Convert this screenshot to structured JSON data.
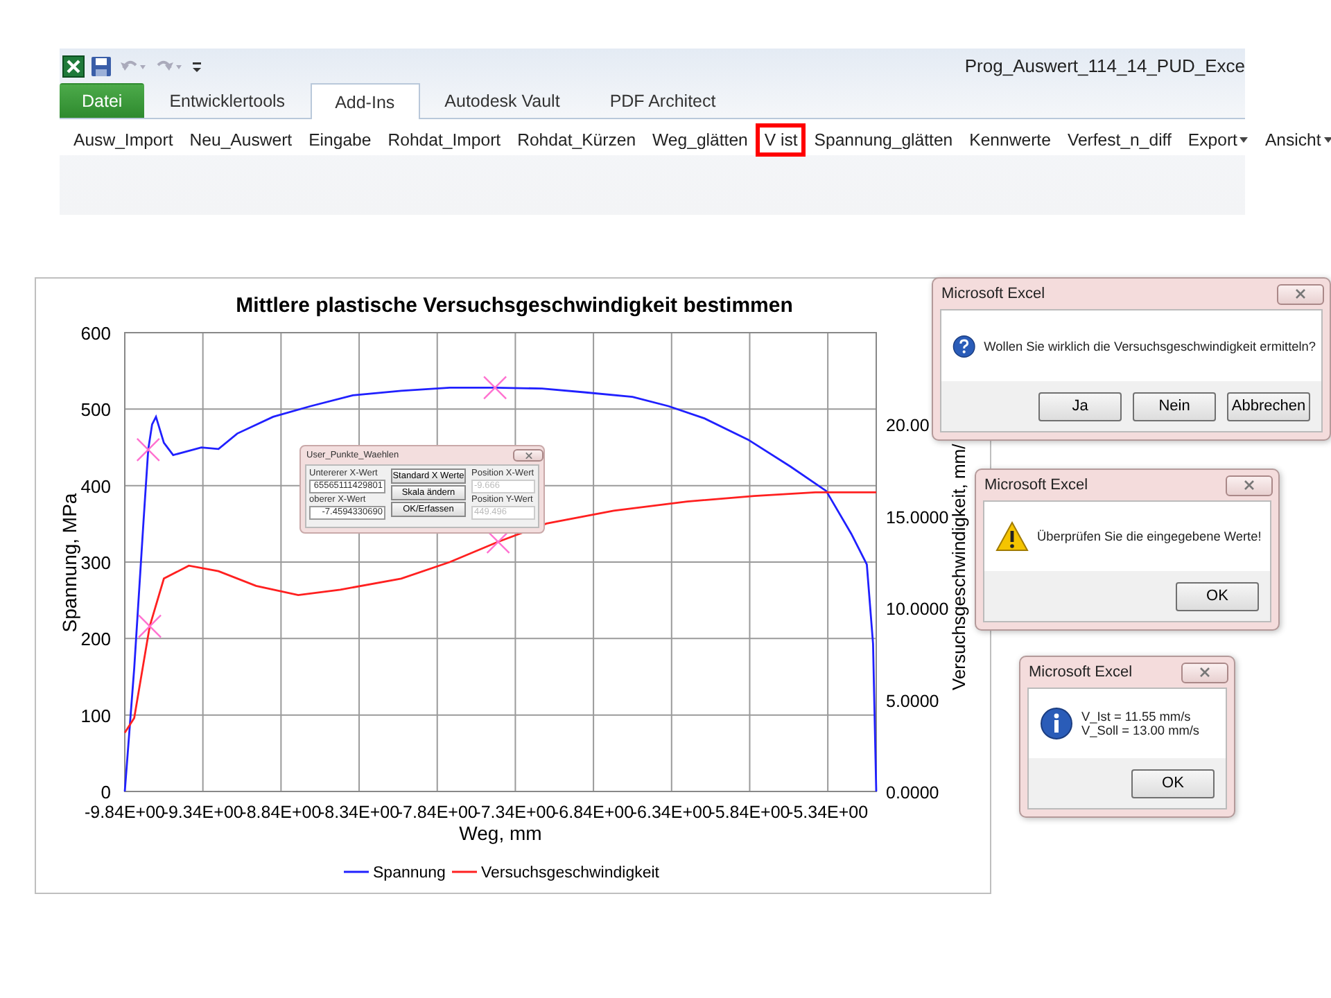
{
  "ribbon": {
    "title": "Prog_Auswert_114_14_PUD_Exce",
    "tabs": [
      {
        "label": "Datei",
        "kind": "file",
        "selected": false
      },
      {
        "label": "Entwicklertools",
        "kind": "tab",
        "selected": false
      },
      {
        "label": "Add-Ins",
        "kind": "tab",
        "selected": true
      },
      {
        "label": "Autodesk Vault",
        "kind": "tab",
        "selected": false
      },
      {
        "label": "PDF Architect",
        "kind": "tab",
        "selected": false
      }
    ],
    "commands": [
      {
        "label": "Ausw_Import",
        "dropdown": false,
        "highlighted": false
      },
      {
        "label": "Neu_Auswert",
        "dropdown": false,
        "highlighted": false
      },
      {
        "label": "Eingabe",
        "dropdown": false,
        "highlighted": false
      },
      {
        "label": "Rohdat_Import",
        "dropdown": false,
        "highlighted": false
      },
      {
        "label": "Rohdat_Kürzen",
        "dropdown": false,
        "highlighted": false
      },
      {
        "label": "Weg_glätten",
        "dropdown": false,
        "highlighted": false
      },
      {
        "label": "V ist",
        "dropdown": false,
        "highlighted": true
      },
      {
        "label": "Spannung_glätten",
        "dropdown": false,
        "highlighted": false
      },
      {
        "label": "Kennwerte",
        "dropdown": false,
        "highlighted": false
      },
      {
        "label": "Verfest_n_diff",
        "dropdown": false,
        "highlighted": false
      },
      {
        "label": "Export",
        "dropdown": true,
        "highlighted": false
      },
      {
        "label": "Ansicht",
        "dropdown": true,
        "highlighted": false
      }
    ]
  },
  "chart": {
    "chart_data": {
      "type": "line",
      "title": "Mittlere plastische Versuchsgeschwindigkeit bestimmen",
      "xlabel": "Weg, mm",
      "ylabel": "Spannung, MPa",
      "y2label": "Versuchsgeschwindigkeit, mm/",
      "xlim": [
        -9.84,
        -5.03
      ],
      "ylim": [
        0,
        600
      ],
      "y2lim": [
        0,
        25
      ],
      "xticks": [
        {
          "value": -9.84,
          "label": "-9.84E+00"
        },
        {
          "value": -9.34,
          "label": "-9.34E+00"
        },
        {
          "value": -8.84,
          "label": "-8.84E+00"
        },
        {
          "value": -8.34,
          "label": "-8.34E+00"
        },
        {
          "value": -7.84,
          "label": "-7.84E+00"
        },
        {
          "value": -7.34,
          "label": "-7.34E+00"
        },
        {
          "value": -6.84,
          "label": "-6.84E+00"
        },
        {
          "value": -6.34,
          "label": "-6.34E+00"
        },
        {
          "value": -5.84,
          "label": "-5.84E+00"
        },
        {
          "value": -5.34,
          "label": "-5.34E+00"
        }
      ],
      "yticks": [
        0,
        100,
        200,
        300,
        400,
        500,
        600
      ],
      "y2ticks": [
        {
          "value": 0,
          "label": "0.0000"
        },
        {
          "value": 5,
          "label": "5.0000"
        },
        {
          "value": 10,
          "label": "10.0000"
        },
        {
          "value": 15,
          "label": "15.0000"
        },
        {
          "value": 20,
          "label": "20.00"
        }
      ],
      "grid": true,
      "legend": true,
      "series": [
        {
          "name": "Spannung",
          "color": "#2020ff",
          "axis": "y",
          "x": [
            -9.84,
            -9.78,
            -9.72,
            -9.69,
            -9.665,
            -9.64,
            -9.59,
            -9.53,
            -9.35,
            -9.24,
            -9.12,
            -8.89,
            -8.65,
            -8.38,
            -8.07,
            -7.76,
            -7.47,
            -7.17,
            -6.9,
            -6.59,
            -6.36,
            -6.13,
            -5.85,
            -5.58,
            -5.35,
            -5.19,
            -5.09,
            -5.05,
            -5.03
          ],
          "values": [
            0,
            161,
            353,
            447,
            480,
            490,
            456,
            440,
            450,
            448,
            468,
            490,
            504,
            518,
            524,
            528,
            528,
            527,
            522,
            516,
            504,
            488,
            460,
            425,
            393,
            337,
            297,
            193,
            0
          ]
        },
        {
          "name": "Versuchsgeschwindigkeit",
          "color": "#ff2020",
          "axis": "y2",
          "x": [
            -9.84,
            -9.78,
            -9.68,
            -9.59,
            -9.43,
            -9.24,
            -9.0,
            -8.73,
            -8.46,
            -8.07,
            -7.76,
            -7.45,
            -7.14,
            -6.71,
            -6.24,
            -5.81,
            -5.42,
            -5.03
          ],
          "values": [
            3.2,
            4.0,
            9.0,
            11.6,
            12.3,
            12.0,
            11.2,
            10.7,
            11.0,
            11.6,
            12.5,
            13.6,
            14.6,
            15.3,
            15.8,
            16.1,
            16.3,
            16.3
          ]
        }
      ]
    }
  },
  "point_dialog": {
    "title": "User_Punkte_Waehlen",
    "left_fields": [
      {
        "label": "Untererer X-Wert",
        "value": "65565111429801",
        "disabled": false
      },
      {
        "label": "oberer X-Wert",
        "value": "-7.4594330690",
        "disabled": false
      }
    ],
    "buttons": [
      "Standard X Werte",
      "Skala ändern",
      "OK/Erfassen"
    ],
    "right_fields": [
      {
        "label": "Position X-Wert",
        "value": "-9.666",
        "disabled": true
      },
      {
        "label": "Position Y-Wert",
        "value": "449.496",
        "disabled": true
      }
    ]
  },
  "message_boxes": [
    {
      "title": "Microsoft Excel",
      "kind": "question",
      "message": [
        "Wollen Sie wirklich die Versuchsgeschwindigkeit ermitteln?"
      ],
      "buttons": [
        "Ja",
        "Nein",
        "Abbrechen"
      ]
    },
    {
      "title": "Microsoft Excel",
      "kind": "warning",
      "message": [
        "Überprüfen Sie die eingegebene Werte!"
      ],
      "buttons": [
        "OK"
      ]
    },
    {
      "title": "Microsoft Excel",
      "kind": "info",
      "message": [
        "V_Ist = 11.55 mm/s",
        "V_Soll = 13.00 mm/s"
      ],
      "buttons": [
        "OK"
      ]
    }
  ]
}
